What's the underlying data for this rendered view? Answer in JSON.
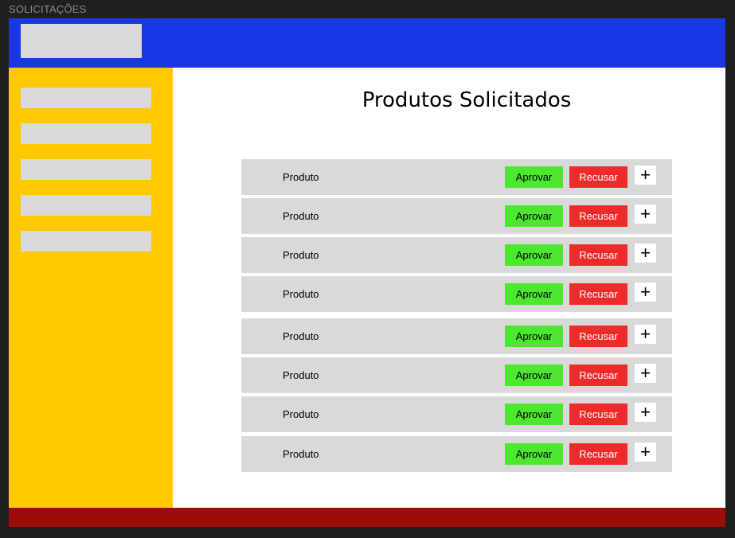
{
  "frame_title": "SOLICITAÇÕES",
  "page_title": "Produtos Solicitados",
  "colors": {
    "header": "#1a37e6",
    "sidebar": "#ffc800",
    "footer": "#9e0b0b",
    "approve": "#4be82f",
    "reject": "#ee2b2b",
    "placeholder": "#d9d9d9"
  },
  "rows": [
    {
      "label": "Produto",
      "approve": "Aprovar",
      "reject": "Recusar",
      "more": "+"
    },
    {
      "label": "Produto",
      "approve": "Aprovar",
      "reject": "Recusar",
      "more": "+"
    },
    {
      "label": "Produto",
      "approve": "Aprovar",
      "reject": "Recusar",
      "more": "+"
    },
    {
      "label": "Produto",
      "approve": "Aprovar",
      "reject": "Recusar",
      "more": "+"
    },
    {
      "label": "Produto",
      "approve": "Aprovar",
      "reject": "Recusar",
      "more": "+"
    },
    {
      "label": "Produto",
      "approve": "Aprovar",
      "reject": "Recusar",
      "more": "+"
    },
    {
      "label": "Produto",
      "approve": "Aprovar",
      "reject": "Recusar",
      "more": "+"
    },
    {
      "label": "Produto",
      "approve": "Aprovar",
      "reject": "Recusar",
      "more": "+"
    }
  ]
}
